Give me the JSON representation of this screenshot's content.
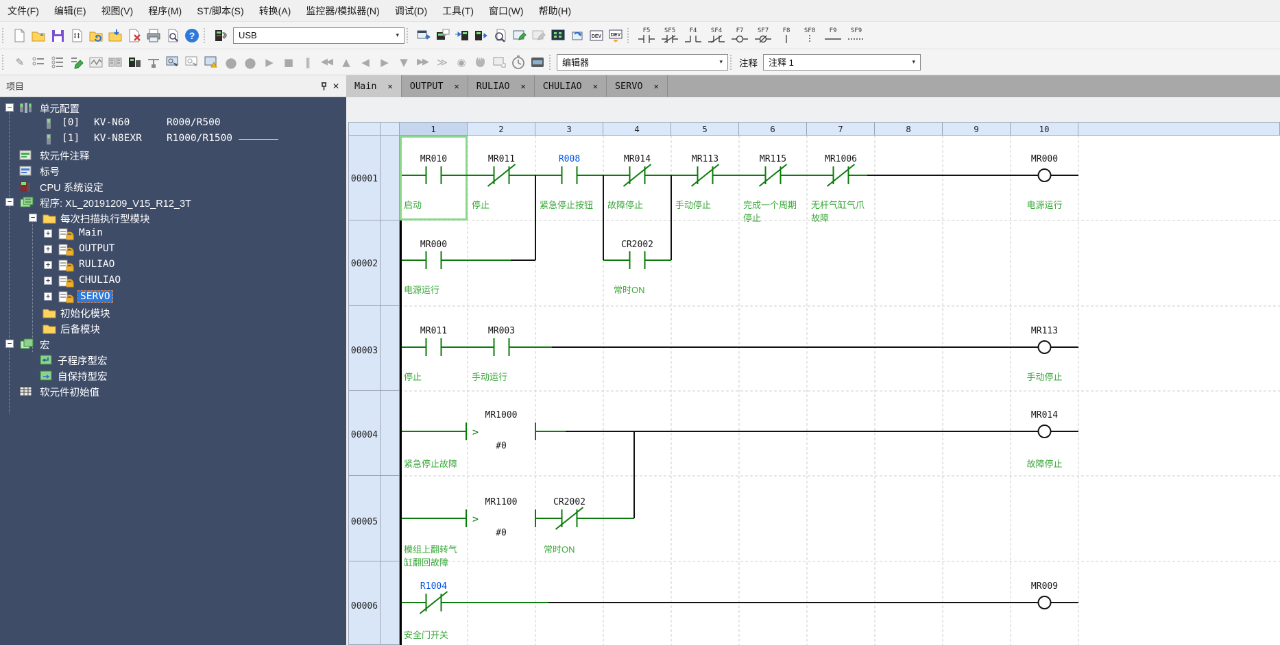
{
  "menu_items": [
    "文件(F)",
    "编辑(E)",
    "视图(V)",
    "程序(M)",
    "ST/脚本(S)",
    "转换(A)",
    "监控器/模拟器(N)",
    "调试(D)",
    "工具(T)",
    "窗口(W)",
    "帮助(H)"
  ],
  "toolbar1": {
    "usb_value": "USB",
    "dev_label": "DEV",
    "fkeys": [
      "F5",
      "SF5",
      "F4",
      "SF4",
      "F7",
      "SF7",
      "F8",
      "SF8",
      "F9",
      "SF9"
    ]
  },
  "toolbar2": {
    "editor_value": "编辑器",
    "comment_label": "注释",
    "comment_value": "注释 1"
  },
  "glyphs": {
    "close": "✕",
    "dropdown": "▾",
    "help": "?",
    "minus": "−",
    "plus": "+",
    "record": "●",
    "play": "▶",
    "stop": "■",
    "pause": "‖",
    "skip_back": "◀◀",
    "step_up": "▲",
    "step_prev": "◀",
    "step_next": "▶",
    "step_down": "▼",
    "skip_fwd": "▶▶",
    "continue": "≫",
    "target": "◉",
    "pencil": "✎"
  },
  "panel": {
    "title": "项目"
  },
  "tree": [
    {
      "label": "单元配置"
    },
    {
      "index": "[0]",
      "name": "KV-N60",
      "range": "R000/R500"
    },
    {
      "index": "[1]",
      "name": "KV-N8EXR",
      "range": "R1000/R1500"
    },
    {
      "label": "软元件注释"
    },
    {
      "label": "标号"
    },
    {
      "label": "CPU 系统设定"
    },
    {
      "label": "程序: XL_20191209_V15_R12_3T"
    },
    {
      "label": "每次扫描执行型模块"
    },
    {
      "label": "Main"
    },
    {
      "label": "OUTPUT"
    },
    {
      "label": "RULIAO"
    },
    {
      "label": "CHULIAO"
    },
    {
      "label": "SERVO"
    },
    {
      "label": "初始化模块"
    },
    {
      "label": "后备模块"
    },
    {
      "label": "宏"
    },
    {
      "label": "子程序型宏"
    },
    {
      "label": "自保持型宏"
    },
    {
      "label": "软元件初始值"
    }
  ],
  "tabs": [
    "Main",
    "OUTPUT",
    "RULIAO",
    "CHULIAO",
    "SERVO"
  ],
  "ladder": {
    "columns": [
      "1",
      "2",
      "3",
      "4",
      "5",
      "6",
      "7",
      "8",
      "9",
      "10"
    ],
    "rows": [
      {
        "num": "00001",
        "c": [
          {
            "l": "MR010",
            "t": "启动"
          },
          {
            "l": "MR011",
            "t": "停止"
          },
          {
            "l": "R008",
            "t": "紧急停止按钮"
          },
          {
            "l": "MR014",
            "t": "故障停止"
          },
          {
            "l": "MR113",
            "t": "手动停止"
          },
          {
            "l": "MR115",
            "t": "完成一个周期\n停止"
          },
          {
            "l": "MR1006",
            "t": "无杆气缸气爪\n故障"
          }
        ],
        "coil": {
          "l": "MR000",
          "t": "电源运行"
        }
      },
      {
        "num": "00002",
        "c": [
          {
            "l": "MR000",
            "t": "电源运行"
          },
          {
            "l": "CR2002",
            "t": "常时ON"
          }
        ]
      },
      {
        "num": "00003",
        "c": [
          {
            "l": "MR011",
            "t": "停止"
          },
          {
            "l": "MR003",
            "t": "手动运行"
          }
        ],
        "coil": {
          "l": "MR113",
          "t": "手动停止"
        }
      },
      {
        "num": "00004",
        "c": [
          {
            "l": "MR1000",
            "op": ">",
            "v": "#0",
            "t": "紧急停止故障"
          }
        ],
        "coil": {
          "l": "MR014",
          "t": "故障停止"
        }
      },
      {
        "num": "00005",
        "c": [
          {
            "l": "MR1100",
            "op": ">",
            "v": "#0",
            "t": "模组上翻转气\n缸翻回故障"
          },
          {
            "l": "CR2002",
            "t": "常时ON"
          }
        ]
      },
      {
        "num": "00006",
        "c": [
          {
            "l": "R1004",
            "t": "安全门开关"
          }
        ],
        "coil": {
          "l": "MR009"
        }
      }
    ]
  }
}
